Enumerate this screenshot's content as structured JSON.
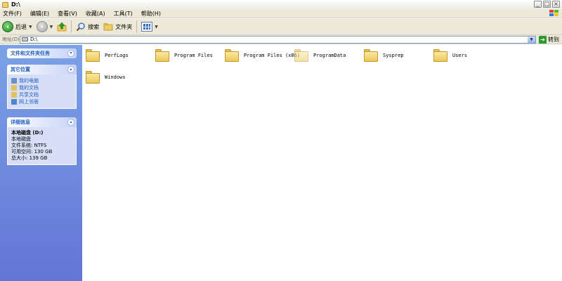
{
  "window": {
    "title": "D:\\",
    "buttons": {
      "minimize": "_",
      "maximize": "□",
      "close": "×"
    }
  },
  "menu": {
    "items": [
      {
        "label": "文件(F)"
      },
      {
        "label": "编辑(E)"
      },
      {
        "label": "查看(V)"
      },
      {
        "label": "收藏(A)"
      },
      {
        "label": "工具(T)"
      },
      {
        "label": "帮助(H)"
      }
    ]
  },
  "toolbar": {
    "back_label": "后退",
    "search_label": "搜索",
    "folders_label": "文件夹"
  },
  "address": {
    "label": "地址(D)",
    "value": "D:\\",
    "go_label": "转到"
  },
  "sidebar": {
    "file_tasks": {
      "title": "文件和文件夹任务"
    },
    "other_places": {
      "title": "其它位置",
      "items": [
        {
          "label": "我的电脑",
          "icon": "my-computer-icon",
          "color": "#6e8fc9"
        },
        {
          "label": "我的文档",
          "icon": "my-documents-icon",
          "color": "#e2c15e"
        },
        {
          "label": "共享文档",
          "icon": "shared-documents-icon",
          "color": "#e2c15e"
        },
        {
          "label": "网上邻居",
          "icon": "network-places-icon",
          "color": "#4c86c9"
        }
      ]
    },
    "details": {
      "title": "详细信息",
      "name": "本地磁盘 (D:)",
      "type": "本地磁盘",
      "filesystem": "文件系统: NTFS",
      "free_space": "可用空间: 130 GB",
      "total_size": "总大小: 139 GB"
    }
  },
  "folders": [
    {
      "name": "PerfLogs",
      "faded": false
    },
    {
      "name": "Program Files",
      "faded": false
    },
    {
      "name": "Program Files (x86)",
      "faded": false
    },
    {
      "name": "ProgramData",
      "faded": true
    },
    {
      "name": "Sysprep",
      "faded": false
    },
    {
      "name": "Users",
      "faded": false
    },
    {
      "name": "Windows",
      "faded": false
    }
  ],
  "colors": {
    "sidebar_top": "#7ba2e7",
    "sidebar_bottom": "#6375d6",
    "sidebar_link": "#215dc6",
    "chrome": "#ece9d8"
  }
}
